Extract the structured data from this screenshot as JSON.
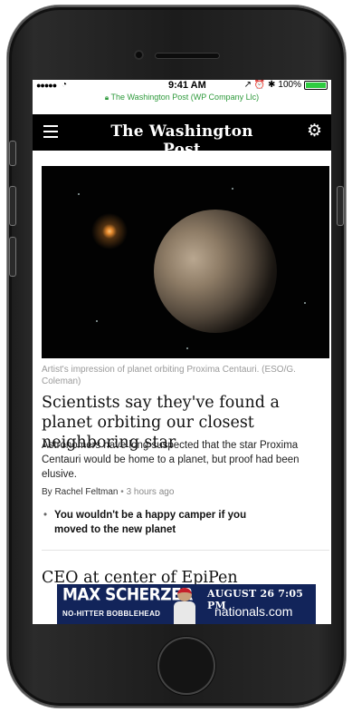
{
  "status_bar": {
    "signal": "●●●●●",
    "time": "9:41 AM",
    "indicators": "↗ ⏰ ✱",
    "battery": "100%"
  },
  "url_bar": {
    "text": "The Washington Post (WP Company Llc)"
  },
  "nav": {
    "masthead": "The Washington Post",
    "menu_icon": "hamburger-menu-icon",
    "settings_icon": "gear-icon"
  },
  "article": {
    "caption": "Artist's impression of planet orbiting Proxima Centauri. (ESO/G. Coleman)",
    "headline": "Scientists say they've found a planet orbiting our closest neighboring star",
    "summary": "Astronomers have long suspected that the star Proxima Centauri would be home to a planet, but proof had been elusive.",
    "byline_author": "By Rachel Feltman",
    "byline_separator": "•",
    "byline_time": "3 hours ago",
    "related_bullet": "•",
    "related": "You wouldn't be a happy camper if you moved to the new planet"
  },
  "next_article": {
    "headline": "CEO at center of EpiPen"
  },
  "ad": {
    "title": "MAX SCHERZER",
    "subtitle": "NO-HITTER BOBBLEHEAD",
    "date": "AUGUST 26  7:05 PM",
    "site": "nationals.com"
  },
  "colors": {
    "navbar": "#000000",
    "url_text": "#2e9a3b",
    "ad_background": "#12245a"
  }
}
